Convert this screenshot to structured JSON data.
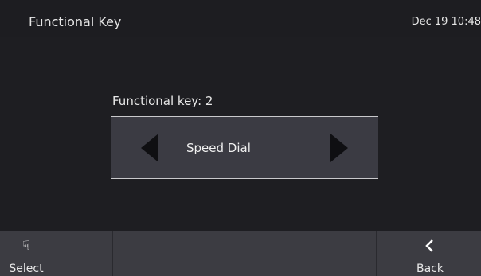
{
  "header": {
    "title": "Functional Key",
    "datetime": "Dec 19 10:48"
  },
  "content": {
    "field_label": "Functional key: 2",
    "selector_value": "Speed Dial",
    "left_arrow_icon": "triangle-left-icon",
    "right_arrow_icon": "triangle-right-icon"
  },
  "softkeys": [
    {
      "label": "Select",
      "icon": "hand-pointer-icon"
    },
    {
      "label": ""
    },
    {
      "label": ""
    },
    {
      "label": "Back",
      "icon": "chevron-left-icon"
    }
  ],
  "colors": {
    "background": "#1e1e22",
    "accent_line": "#3a8fd0",
    "selector_bg": "#3b3b43",
    "softkey_bar": "#3c3c42"
  }
}
